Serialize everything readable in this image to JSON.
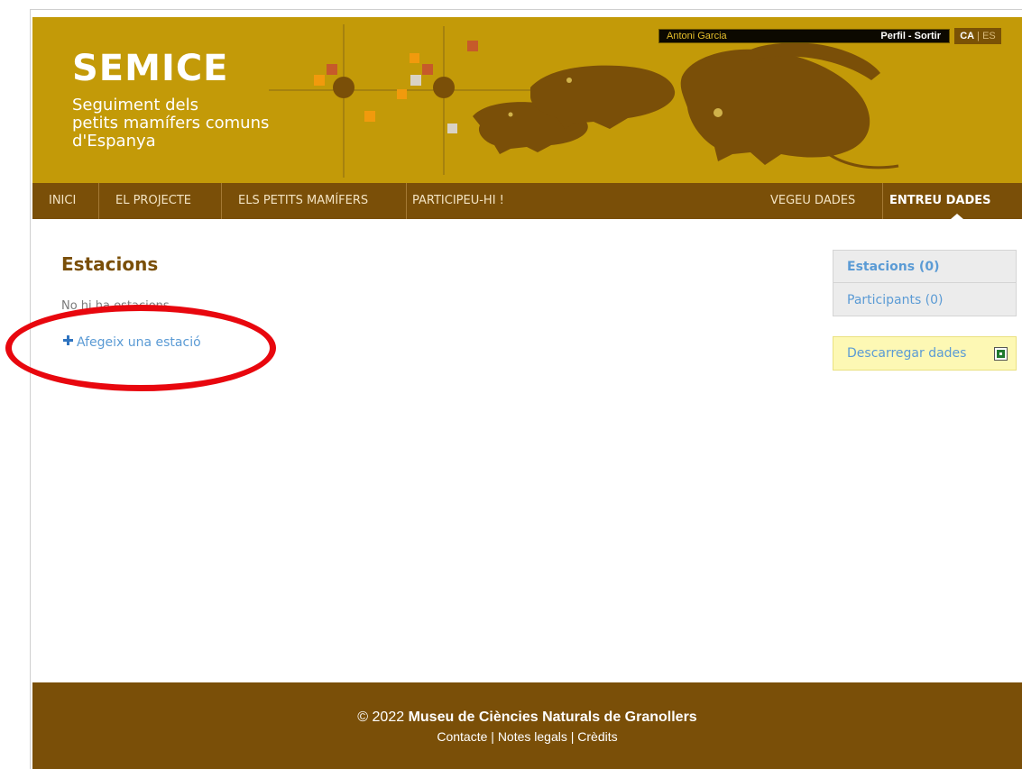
{
  "header": {
    "title": "SEMICE",
    "subtitle_lines": [
      "Seguiment dels",
      "petits mamífers comuns",
      "d'Espanya"
    ],
    "user_name": "Antoni Garcia",
    "profile_link": "Perfil",
    "logout_link": "Sortir",
    "link_separator": " - ",
    "lang_active": "CA",
    "lang_separator": " | ",
    "lang_other": "ES",
    "colors": {
      "header_bg": "#c39a08",
      "nav_bg": "#7a4f08",
      "accent_squares": [
        "#c65a2a",
        "#f19a0d",
        "#d9d2c4"
      ]
    }
  },
  "nav": {
    "items": [
      {
        "label": "INICI"
      },
      {
        "label": "EL PROJECTE"
      },
      {
        "label": "ELS PETITS MAMÍFERS"
      },
      {
        "label": "PARTICIPEU-HI !"
      },
      {
        "label": "VEGEU DADES"
      },
      {
        "label": "ENTREU DADES",
        "active": true
      }
    ]
  },
  "main": {
    "title": "Estacions",
    "empty_message": "No hi ha estacions",
    "add_link": "Afegeix una estació",
    "add_icon": "plus-icon"
  },
  "sidebar": {
    "items": [
      {
        "label": "Estacions (0)",
        "active": true
      },
      {
        "label": "Participants (0)"
      }
    ],
    "download_label": "Descarregar dades",
    "download_icon": "spreadsheet-icon"
  },
  "footer": {
    "copyright_prefix": "© 2022",
    "organization": "Museu de Ciències Naturals de Granollers",
    "links": [
      "Contacte",
      "Notes legals",
      "Crèdits"
    ],
    "link_separator": " | "
  }
}
